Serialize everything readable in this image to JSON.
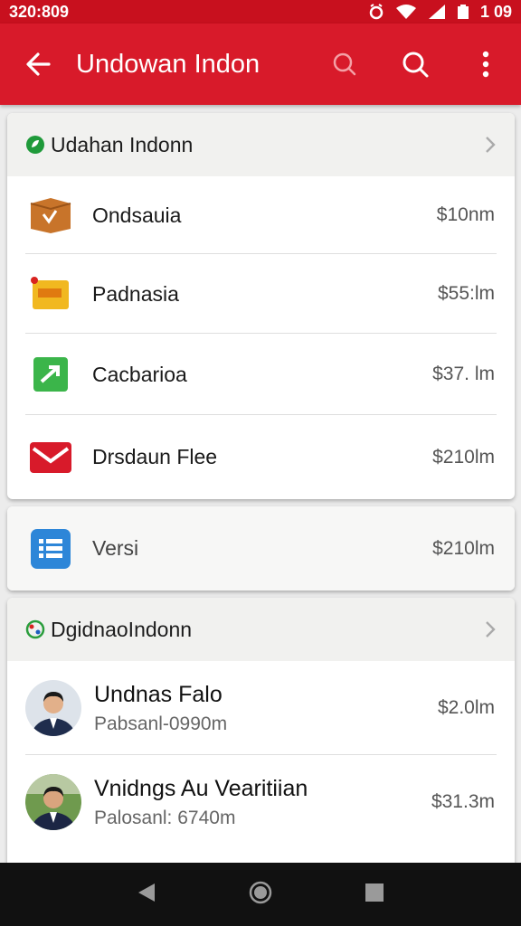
{
  "status": {
    "time": "320:809",
    "clock": "1 09"
  },
  "app_bar": {
    "title": "Undowan Indon"
  },
  "section1": {
    "header": "Udahan Indonn",
    "items": [
      {
        "label": "Ondsauia",
        "price": "$10nm",
        "icon": "package-box-icon"
      },
      {
        "label": "Padnasia",
        "price": "$55:lm",
        "icon": "tag-box-icon"
      },
      {
        "label": "Cacbarioa",
        "price": "$37. lm",
        "icon": "green-arrow-icon"
      },
      {
        "label": "Drsdaun Flee",
        "price": "$210lm",
        "icon": "red-envelope-icon"
      }
    ]
  },
  "section2": {
    "items": [
      {
        "label": "Versi",
        "price": "$210lm",
        "icon": "blue-list-icon"
      }
    ]
  },
  "section3": {
    "header": "DgidnaoIndonn",
    "items": [
      {
        "name": "Undnas Falo",
        "sub": "Pabsanl-0990m",
        "price": "$2.0lm"
      },
      {
        "name": "Vnidngs Au Vearitiian",
        "sub": "Palosanl: 6740m",
        "price": "$31.3m"
      }
    ]
  },
  "colors": {
    "accent": "#d81a2a",
    "status": "#c8101e",
    "nav": "#111111"
  }
}
